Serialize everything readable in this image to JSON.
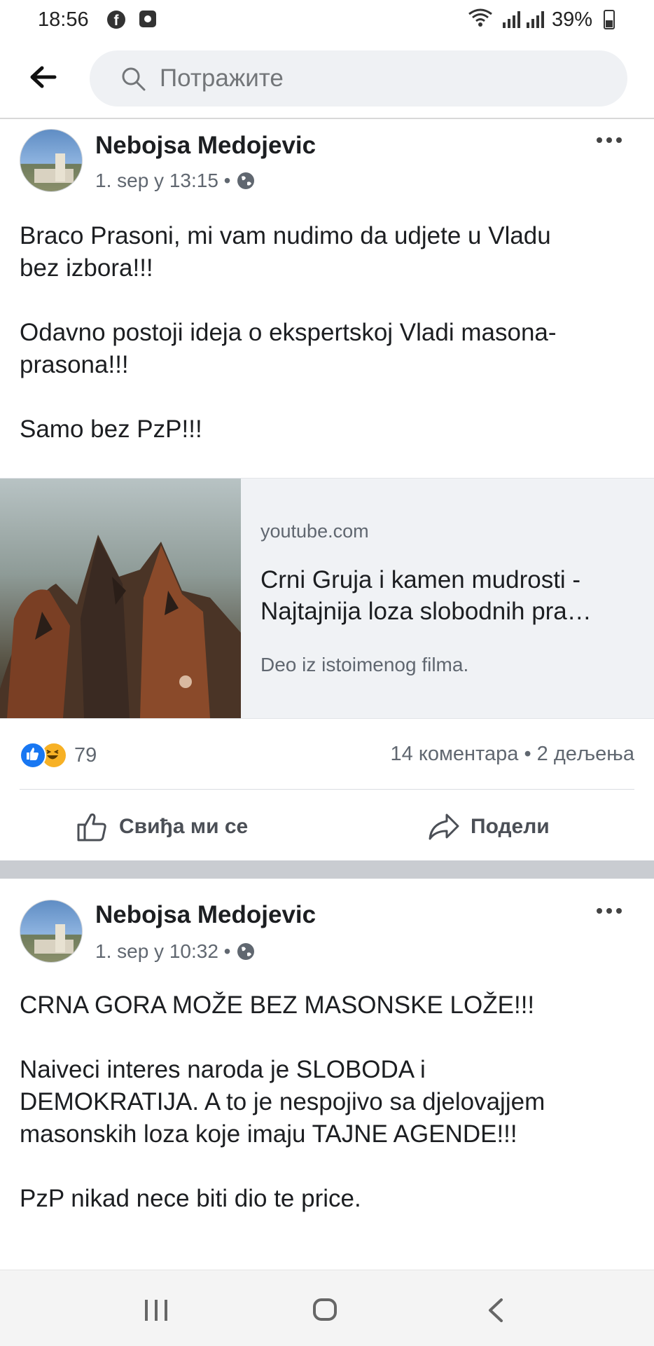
{
  "status_bar": {
    "time": "18:56",
    "battery": "39%",
    "icons": [
      "facebook-icon",
      "app-icon",
      "wifi-icon",
      "signal-icon",
      "signal-icon",
      "battery-icon"
    ]
  },
  "search": {
    "placeholder": "Потражите"
  },
  "posts": [
    {
      "author": "Nebojsa Medojevic",
      "time": "1. sep у 13:15 •",
      "text": [
        "Braco Prasoni, mi vam nudimo da udjete u Vladu",
        "bez izbora!!!",
        "",
        "Odavno postoji ideja o ekspertskoj Vladi masona-",
        "prasona!!!",
        "",
        "Samo bez PzP!!!"
      ],
      "link": {
        "domain": "youtube.com",
        "title_line1": "Crni Gruja i kamen mudrosti -",
        "title_line2": "Najtajnija loza slobodnih pra…",
        "description": "Deo iz istoimenog filma."
      },
      "reactions": {
        "count": "79",
        "comments_shares": "14 коментара • 2 дељења"
      },
      "actions": {
        "like": "Свиђа ми се",
        "share": "Подели"
      }
    },
    {
      "author": "Nebojsa Medojevic",
      "time": "1. sep у 10:32 •",
      "text": [
        "CRNA GORA MOŽE BEZ MASONSKE LOŽE!!!",
        "",
        "Naiveci interes naroda je SLOBODA i",
        "DEMOKRATIJA. A to je nespojivo sa djelovajjem",
        "masonskih loza koje imaju TAJNE AGENDE!!!",
        "",
        "PzP nikad nece biti dio te price."
      ]
    }
  ],
  "colors": {
    "accent": "#1877f2",
    "haha": "#f7b125",
    "separator": "#c9ccd1"
  }
}
